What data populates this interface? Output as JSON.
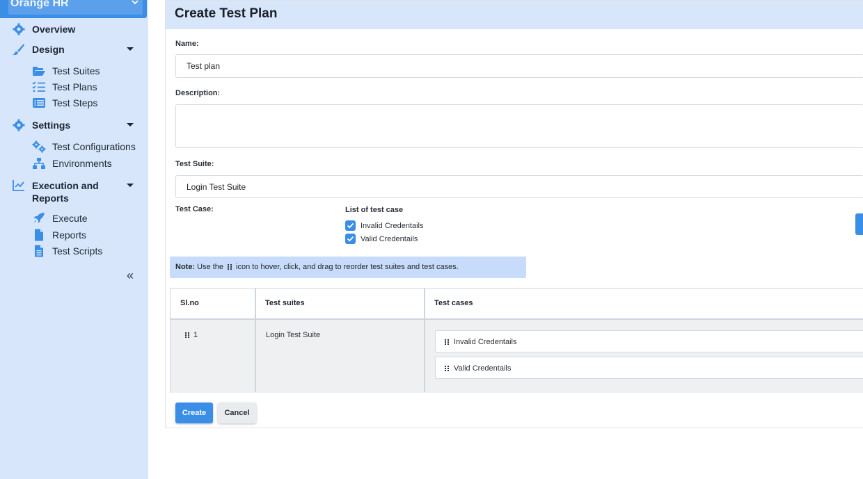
{
  "sidebar": {
    "project": "Orange HR",
    "items": [
      {
        "label": "Overview",
        "icon": "gear-icon"
      },
      {
        "label": "Design",
        "icon": "brush-icon",
        "children": [
          {
            "label": "Test Suites",
            "icon": "folder-open-icon"
          },
          {
            "label": "Test Plans",
            "icon": "checklist-icon"
          },
          {
            "label": "Test Steps",
            "icon": "list-icon"
          }
        ]
      },
      {
        "label": "Settings",
        "icon": "gear-icon",
        "children": [
          {
            "label": "Test Configurations",
            "icon": "gears-icon"
          },
          {
            "label": "Environments",
            "icon": "network-icon"
          }
        ]
      },
      {
        "label": "Execution and Reports",
        "icon": "chart-line-icon",
        "children": [
          {
            "label": "Execute",
            "icon": "rocket-icon"
          },
          {
            "label": "Reports",
            "icon": "file-icon"
          },
          {
            "label": "Test Scripts",
            "icon": "file-lines-icon"
          }
        ]
      }
    ],
    "collapse_label": "«"
  },
  "page": {
    "title": "Create Test Plan",
    "name_label": "Name:",
    "name_value": "Test plan",
    "description_label": "Description:",
    "description_value": "",
    "suite_label": "Test Suite:",
    "suite_value": "Login Test Suite",
    "case_label": "Test Case:",
    "case_list_title": "List of test case",
    "cases": [
      {
        "label": "Invalid Credentails",
        "checked": true
      },
      {
        "label": "Valid Credentails",
        "checked": true
      }
    ],
    "note_prefix": "Note:",
    "note_before": "Use the",
    "note_after": "icon to hover, click, and drag to reorder test suites and test cases.",
    "table": {
      "headers": [
        "Sl.no",
        "Test suites",
        "Test cases"
      ],
      "rows": [
        {
          "sl": "1",
          "suite": "Login Test Suite",
          "cases": [
            "Invalid Credentails",
            "Valid Credentails"
          ]
        }
      ]
    },
    "create_label": "Create",
    "cancel_label": "Cancel"
  },
  "colors": {
    "accent": "#3a8ee6",
    "sidebar_bg": "#d8e6fb",
    "note_bg": "#c6dcfa"
  }
}
